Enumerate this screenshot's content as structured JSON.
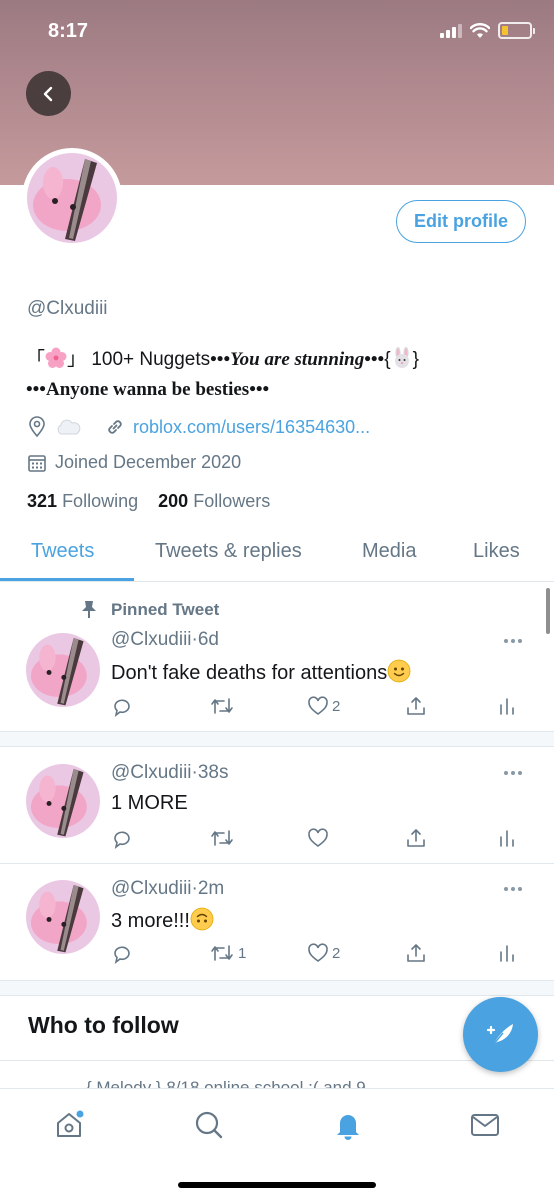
{
  "status_bar": {
    "time": "8:17"
  },
  "profile": {
    "handle": "@Clxudiii",
    "edit_profile_label": "Edit profile",
    "bio_bracket_open": "「",
    "bio_bracket_close": "」",
    "bio_part1": "100+ Nuggets",
    "bio_dots": "•••",
    "bio_part2": "You are stunning",
    "bio_brace_open": "{",
    "bio_brace_close": "}",
    "bio_part3": "Anyone wanna be besties",
    "website": "roblox.com/users/16354630...",
    "joined": "Joined December 2020",
    "following_count": "321",
    "following_label": "Following",
    "followers_count": "200",
    "followers_label": "Followers"
  },
  "tabs": [
    {
      "label": "Tweets",
      "active": true
    },
    {
      "label": "Tweets & replies"
    },
    {
      "label": "Media"
    },
    {
      "label": "Likes"
    }
  ],
  "tweets": [
    {
      "pinned_label": "Pinned Tweet",
      "handle": "@Clxudiii",
      "time": "6d",
      "text": "Don't fake deaths for attentions",
      "emoji": "slightly-smiling-face",
      "likes": "2",
      "retweets": ""
    },
    {
      "handle": "@Clxudiii",
      "time": "38s",
      "text": "1 MORE",
      "likes": "",
      "retweets": ""
    },
    {
      "handle": "@Clxudiii",
      "time": "2m",
      "text": "3 more!!!",
      "emoji": "upside-down-face",
      "likes": "2",
      "retweets": "1"
    }
  ],
  "who_to_follow": {
    "title": "Who to follow",
    "peek_text": "{ Melody } 8/18 online school :( and 9"
  },
  "colors": {
    "accent": "#4aa3e0",
    "banner": "#b58c90",
    "muted": "#657786"
  }
}
